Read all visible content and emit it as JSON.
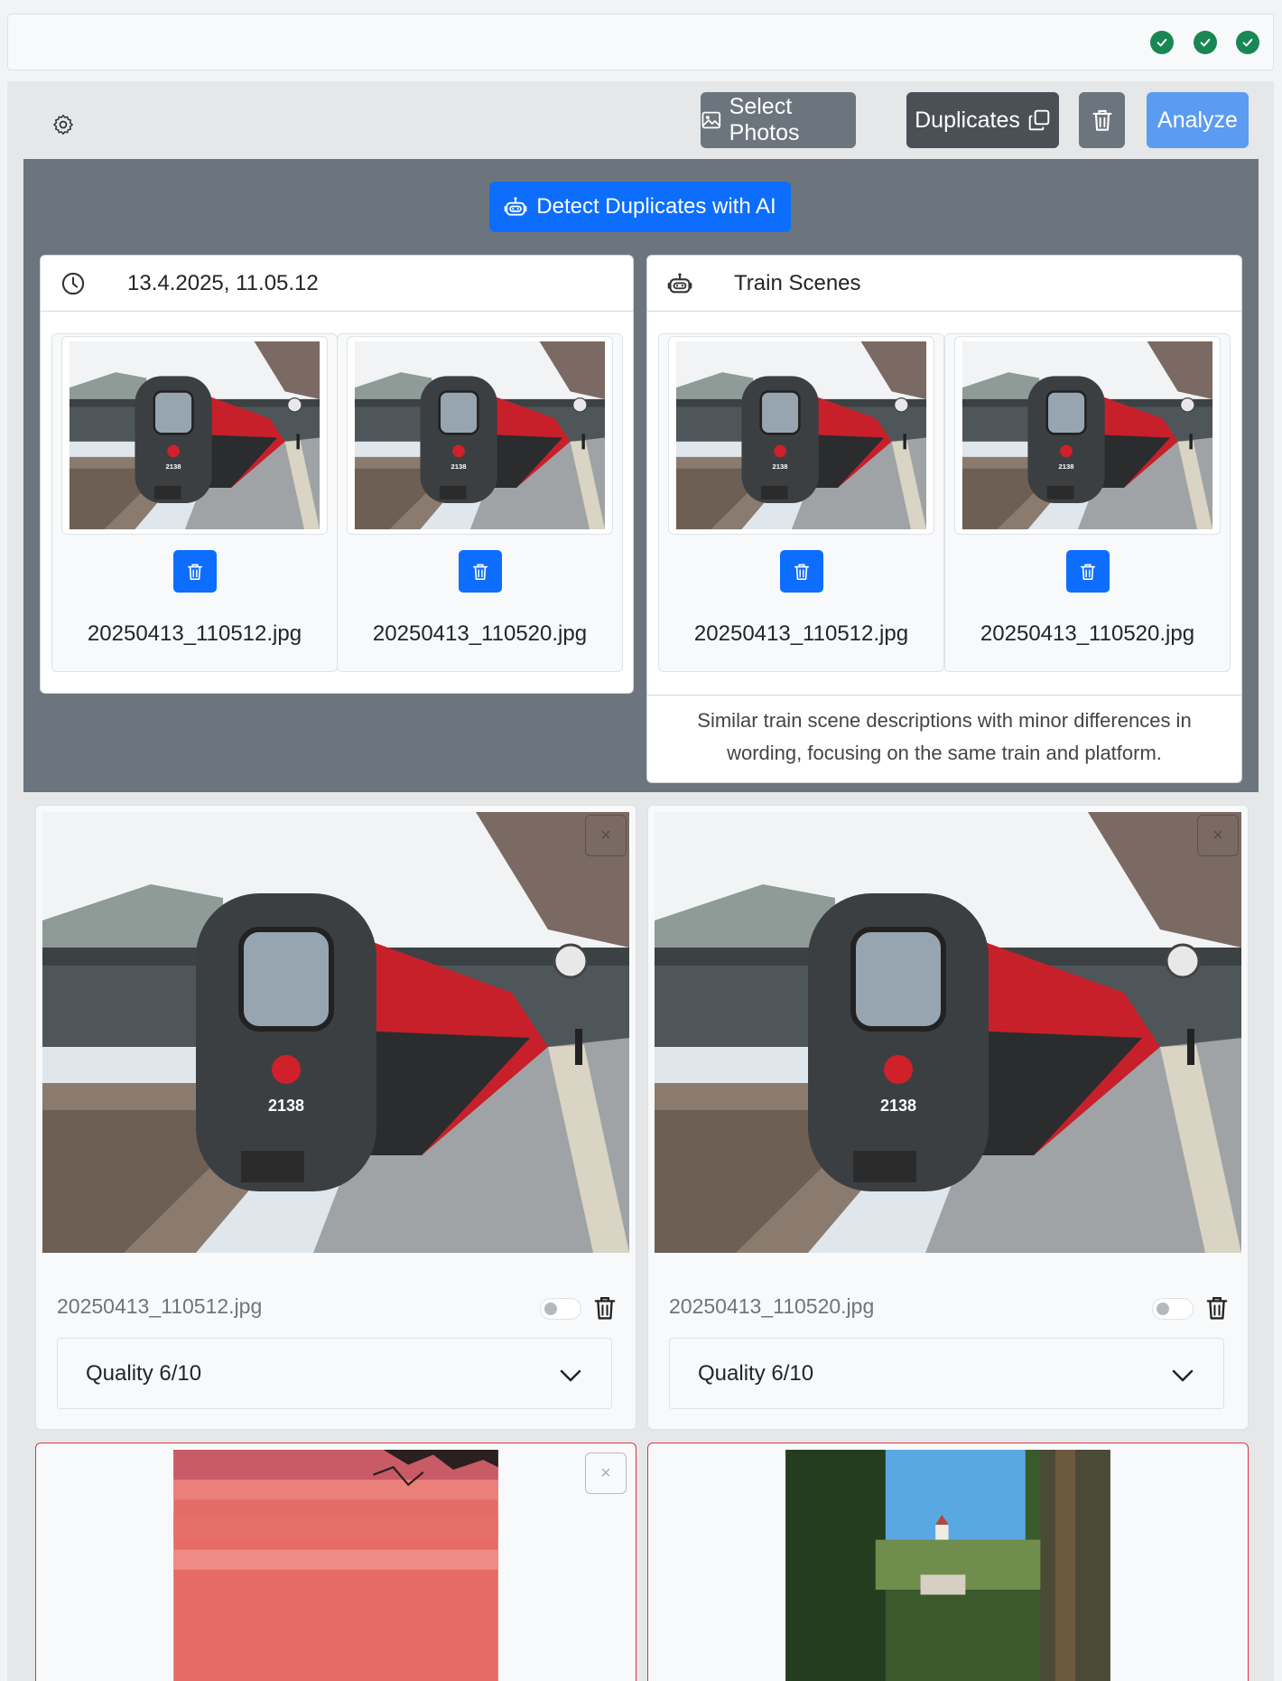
{
  "status": {
    "checks": [
      "check-circle-icon",
      "check-circle-icon",
      "check-circle-icon"
    ],
    "check_color": "#198754"
  },
  "toolbar": {
    "select_photos_label": "Select Photos",
    "duplicates_label": "Duplicates",
    "analyze_label": "Analyze"
  },
  "duplicates": {
    "detect_label": "Detect Duplicates with AI",
    "groups": [
      {
        "icon": "clock-icon",
        "title": "13.4.2025, 11.05.12",
        "items": [
          {
            "filename": "20250413_110512.jpg"
          },
          {
            "filename": "20250413_110520.jpg"
          }
        ]
      },
      {
        "icon": "robot-icon",
        "title": "Train Scenes",
        "items": [
          {
            "filename": "20250413_110512.jpg"
          },
          {
            "filename": "20250413_110520.jpg"
          }
        ],
        "description": "Similar train scene descriptions with minor differences in wording, focusing on the same train and platform."
      }
    ]
  },
  "photos": [
    {
      "filename": "20250413_110512.jpg",
      "quality": "Quality 6/10",
      "close": "×"
    },
    {
      "filename": "20250413_110520.jpg",
      "quality": "Quality 6/10",
      "close": "×"
    }
  ],
  "colors": {
    "primary": "#0d6efd",
    "secondary": "#6c757d",
    "analyze": "#5b9bf2",
    "danger_border": "#dc3545"
  }
}
